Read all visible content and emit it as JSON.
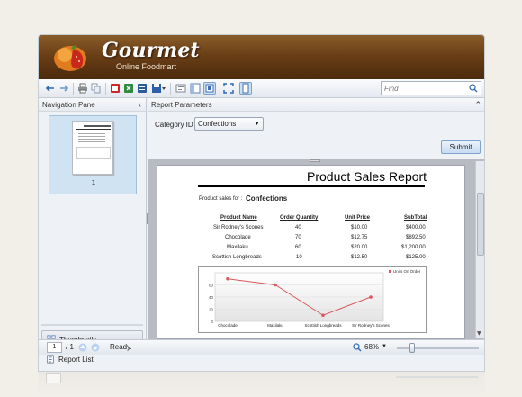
{
  "app": {
    "brand": "Gourmet",
    "tagline": "Online Foodmart"
  },
  "toolbar": {
    "buttons": [
      "back-icon",
      "forward-icon",
      "print-icon",
      "copy-icon",
      "pdf-icon",
      "excel-icon",
      "word-icon",
      "save-icon",
      "export-icon",
      "parameters-icon",
      "navigation-pane-icon",
      "fit-page-icon",
      "full-screen-icon",
      "single-page-icon"
    ],
    "find_placeholder": "Find"
  },
  "nav_pane": {
    "title": "Navigation Pane",
    "thumbnail_page": "1",
    "tabs": [
      {
        "label": "Thumbnails",
        "icon": "thumbnails-icon"
      },
      {
        "label": "Report List",
        "icon": "report-list-icon"
      }
    ]
  },
  "params": {
    "title": "Report Parameters",
    "category_label": "Category ID",
    "category_value": "Confections",
    "submit_label": "Submit"
  },
  "report": {
    "title": "Product Sales Report",
    "for_label": "Product sales for :",
    "for_value": "Confections",
    "columns": [
      "Product Name",
      "Order Quantity",
      "Unit Price",
      "SubTotal"
    ],
    "rows": [
      [
        "Sir Rodney's Scones",
        "40",
        "$10.00",
        "$400.00"
      ],
      [
        "Chocolade",
        "70",
        "$12.75",
        "$892.50"
      ],
      [
        "Maxilaku",
        "60",
        "$20.00",
        "$1,200.00"
      ],
      [
        "Scottish Longbreads",
        "10",
        "$12.50",
        "$125.00"
      ]
    ]
  },
  "chart_data": {
    "type": "line",
    "categories": [
      "Chocolade",
      "Maxilaku",
      "Scottish Longbreads",
      "Sir Rodney's Scones"
    ],
    "series": [
      {
        "name": "Units On Order",
        "values": [
          70,
          60,
          10,
          40
        ]
      }
    ],
    "yticks": [
      "0",
      "20",
      "40",
      "60"
    ],
    "ylim": [
      0,
      80
    ],
    "legend": "top-right",
    "color": "#d9575c"
  },
  "status": {
    "page": "1",
    "of": "/  1",
    "text": "Ready.",
    "zoom": "68%"
  }
}
